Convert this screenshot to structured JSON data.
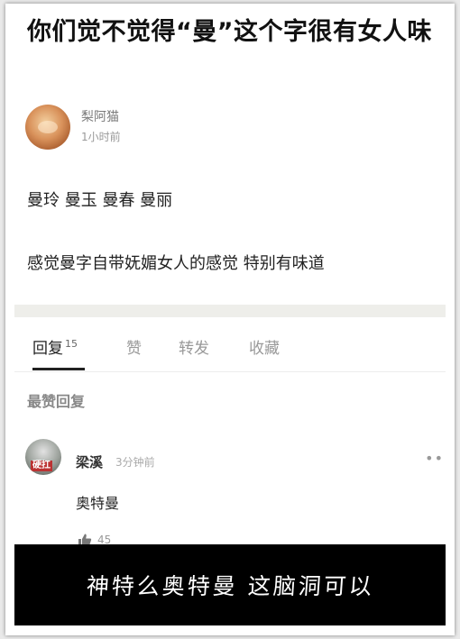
{
  "post": {
    "title": "你们觉不觉得“曼”这个字很有女人味",
    "author": {
      "name": "梨阿猫",
      "time": "1小时前"
    },
    "body_line1": "曼玲 曼玉 曼春 曼丽",
    "body_line2": "感觉曼字自带妩媚女人的感觉  特别有味道"
  },
  "tabs": [
    {
      "label": "回复",
      "count": "15",
      "active": true
    },
    {
      "label": "赞"
    },
    {
      "label": "转发"
    },
    {
      "label": "收藏"
    }
  ],
  "section_label": "最赞回复",
  "reply": {
    "avatar_text": "硬扛",
    "name": "梁溪",
    "time": "3分钟前",
    "more_icon": "more-dots-icon",
    "text": "奥特曼",
    "likes": "45",
    "like_icon": "thumbs-up-icon"
  },
  "caption": "神特么奥特曼  这脑洞可以"
}
